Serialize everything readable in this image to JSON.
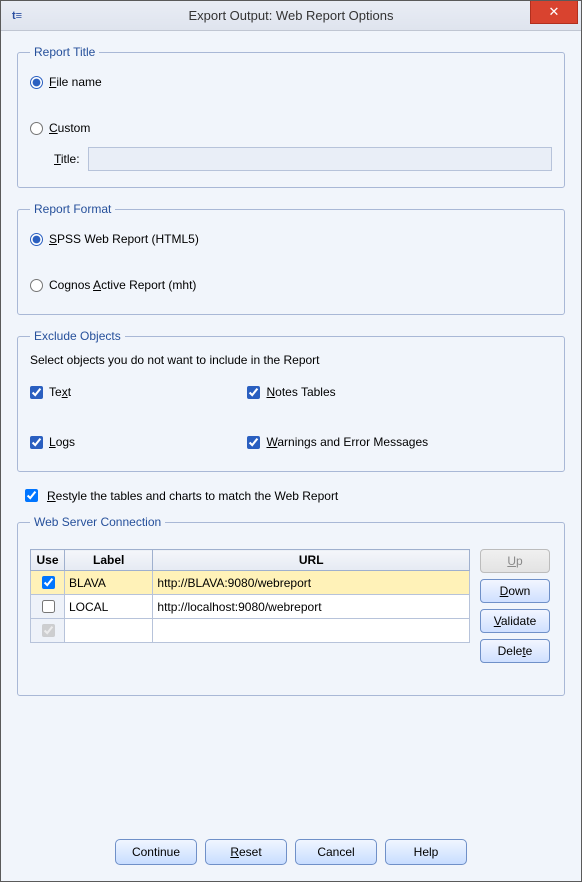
{
  "window": {
    "title": "Export Output: Web Report Options",
    "close_glyph": "✕"
  },
  "report_title": {
    "legend": "Report Title",
    "filename_label_pre": "F",
    "filename_label_post": "ile name",
    "custom_label_pre": "C",
    "custom_label_post": "ustom",
    "title_label_pre": "T",
    "title_label_post": "itle:"
  },
  "report_format": {
    "legend": "Report Format",
    "spss_pre": "S",
    "spss_post": "PSS Web Report (HTML5)",
    "cognos_pre": "Cognos ",
    "cognos_mid": "A",
    "cognos_post": "ctive Report (mht)"
  },
  "exclude": {
    "legend": "Exclude Objects",
    "instruction": "Select objects you do not want to include in the Report",
    "text_pre": "Te",
    "text_mid": "x",
    "text_post": "t",
    "notes_pre": "N",
    "notes_post": "otes Tables",
    "logs_pre": "L",
    "logs_post": "ogs",
    "warn_pre": "W",
    "warn_post": "arnings and Error Messages"
  },
  "restyle": {
    "pre": "R",
    "post": "estyle the tables and charts to match the Web Report"
  },
  "webserver": {
    "legend": "Web Server Connection",
    "col_use": "Use",
    "col_label": "Label",
    "col_url": "URL",
    "rows": [
      {
        "use": true,
        "label": "BLAVA",
        "url": "http://BLAVA:9080/webreport"
      },
      {
        "use": false,
        "label": "LOCAL",
        "url": "http://localhost:9080/webreport"
      }
    ],
    "btn_up_pre": "U",
    "btn_up_post": "p",
    "btn_down_pre": "D",
    "btn_down_post": "own",
    "btn_validate_pre": "V",
    "btn_validate_post": "alidate",
    "btn_delete_pre": "Dele",
    "btn_delete_mid": "t",
    "btn_delete_post": "e"
  },
  "footer": {
    "continue": "Continue",
    "reset_pre": "R",
    "reset_post": "eset",
    "cancel": "Cancel",
    "help": "Help"
  }
}
